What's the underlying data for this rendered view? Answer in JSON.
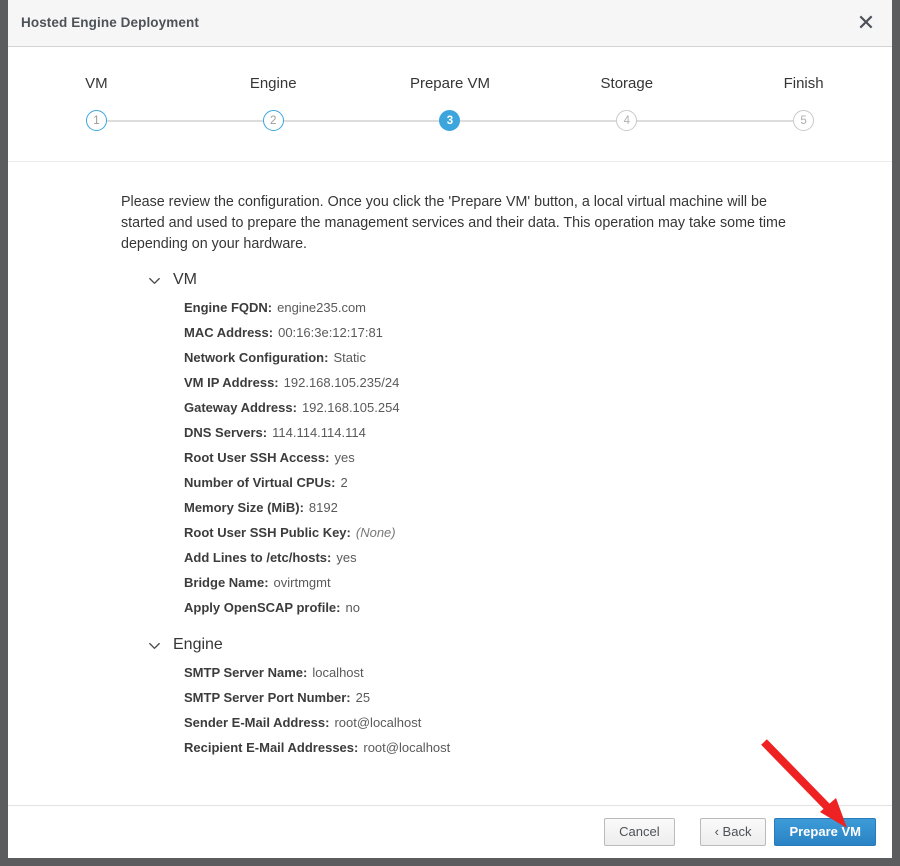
{
  "window": {
    "title": "Hosted Engine Deployment",
    "close_icon": "close-icon",
    "close_glyph": "✕"
  },
  "wizard": {
    "steps": [
      {
        "label": "VM",
        "number": "1",
        "state": "done"
      },
      {
        "label": "Engine",
        "number": "2",
        "state": "done"
      },
      {
        "label": "Prepare VM",
        "number": "3",
        "state": "active"
      },
      {
        "label": "Storage",
        "number": "4",
        "state": "pending"
      },
      {
        "label": "Finish",
        "number": "5",
        "state": "pending"
      }
    ],
    "active_color": "#3ca5dd",
    "pending_color": "#c9c9c9"
  },
  "body": {
    "intro": "Please review the configuration. Once you click the 'Prepare VM' button, a local virtual machine will be started and used to prepare the management services and their data. This operation may take some time depending on your hardware.",
    "sections": [
      {
        "title": "VM",
        "chevron_icon": "chevron-down-icon",
        "expanded": true,
        "rows": [
          {
            "label": "Engine FQDN:",
            "value": "engine235.com",
            "muted": false
          },
          {
            "label": "MAC Address:",
            "value": "00:16:3e:12:17:81",
            "muted": false
          },
          {
            "label": "Network Configuration:",
            "value": "Static",
            "muted": false
          },
          {
            "label": "VM IP Address:",
            "value": "192.168.105.235/24",
            "muted": false
          },
          {
            "label": "Gateway Address:",
            "value": "192.168.105.254",
            "muted": false
          },
          {
            "label": "DNS Servers:",
            "value": "114.114.114.114",
            "muted": false
          },
          {
            "label": "Root User SSH Access:",
            "value": "yes",
            "muted": false
          },
          {
            "label": "Number of Virtual CPUs:",
            "value": "2",
            "muted": false
          },
          {
            "label": "Memory Size (MiB):",
            "value": "8192",
            "muted": false
          },
          {
            "label": "Root User SSH Public Key:",
            "value": "(None)",
            "muted": true
          },
          {
            "label": "Add Lines to /etc/hosts:",
            "value": "yes",
            "muted": false
          },
          {
            "label": "Bridge Name:",
            "value": "ovirtmgmt",
            "muted": false
          },
          {
            "label": "Apply OpenSCAP profile:",
            "value": "no",
            "muted": false
          }
        ]
      },
      {
        "title": "Engine",
        "chevron_icon": "chevron-down-icon",
        "expanded": true,
        "rows": [
          {
            "label": "SMTP Server Name:",
            "value": "localhost",
            "muted": false
          },
          {
            "label": "SMTP Server Port Number:",
            "value": "25",
            "muted": false
          },
          {
            "label": "Sender E-Mail Address:",
            "value": "root@localhost",
            "muted": false
          },
          {
            "label": "Recipient E-Mail Addresses:",
            "value": "root@localhost",
            "muted": false
          }
        ]
      }
    ]
  },
  "footer": {
    "cancel_label": "Cancel",
    "back_label": "‹ Back",
    "primary_label": "Prepare VM",
    "primary_color": "#2e8bcc"
  },
  "annotation": {
    "type": "arrow",
    "color": "#ee2222",
    "points_to": "Prepare VM"
  }
}
